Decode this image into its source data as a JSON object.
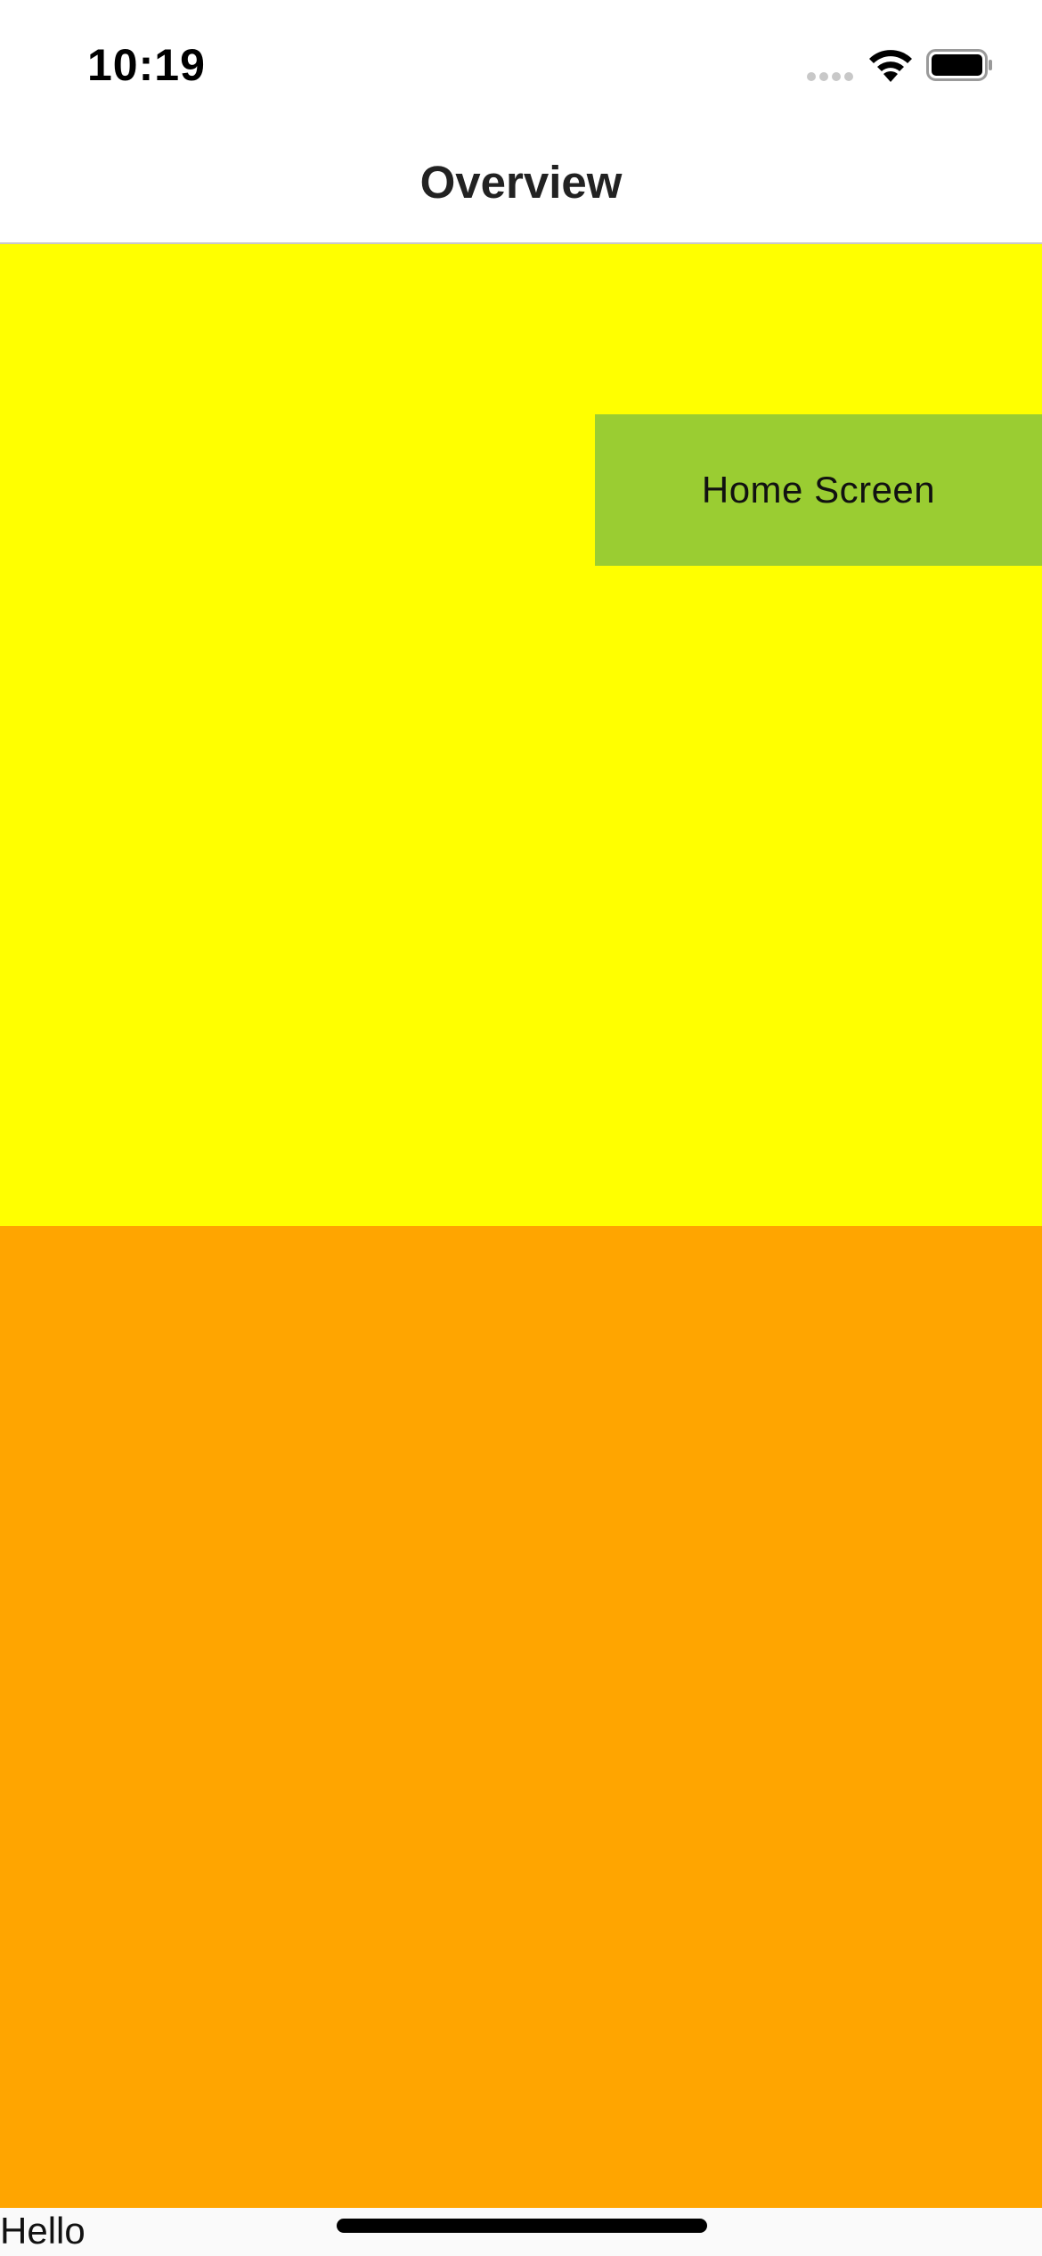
{
  "status_bar": {
    "time": "10:19",
    "icons": [
      "cellular-signal-icon",
      "wifi-icon",
      "battery-icon"
    ]
  },
  "nav_bar": {
    "title": "Overview"
  },
  "content": {
    "top_panel_color": "#ffff00",
    "bottom_panel_color": "#ffa500",
    "button": {
      "label": "Home Screen",
      "color": "#9acd32"
    }
  },
  "footer": {
    "label": "Hello"
  }
}
